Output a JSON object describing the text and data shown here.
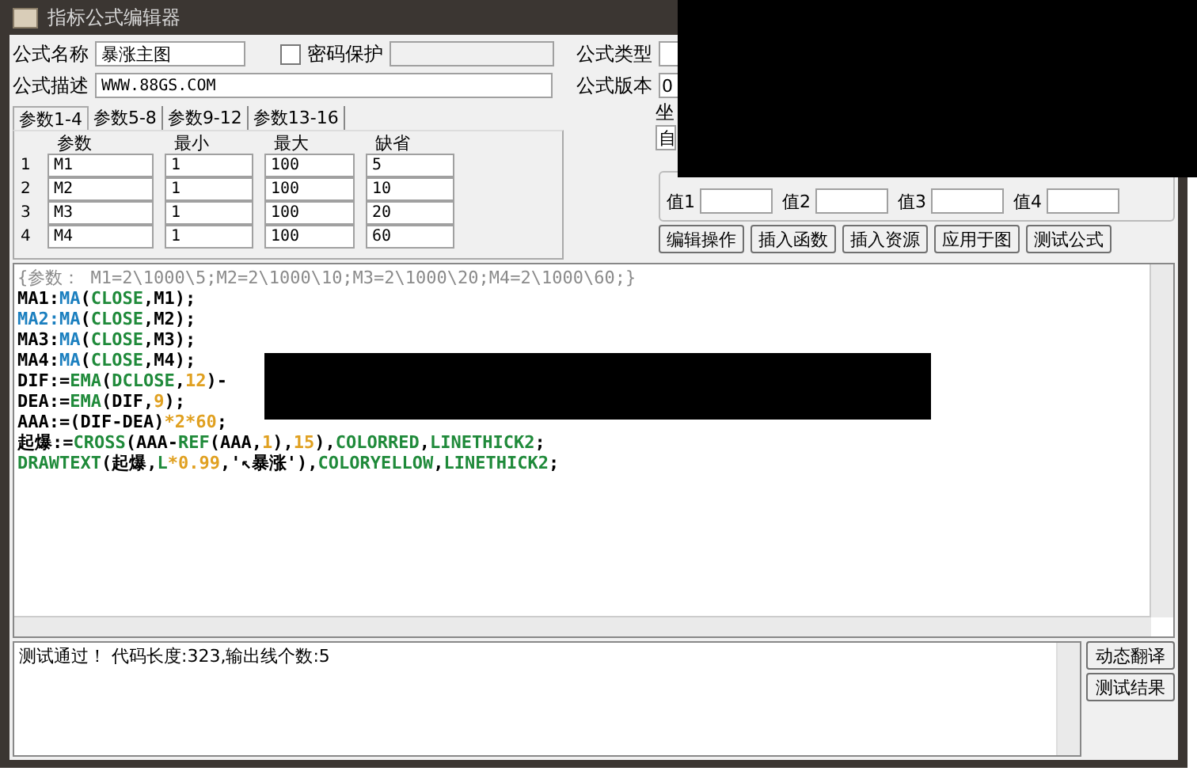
{
  "window": {
    "title": "指标公式编辑器"
  },
  "form": {
    "name_label": "公式名称",
    "name_value": "暴涨主图",
    "password": {
      "label": "密码保护",
      "checked": false
    },
    "type_label": "公式类型",
    "desc_label": "公式描述",
    "desc_value": "WWW.88GS.COM",
    "version_label": "公式版本",
    "version_value": "0",
    "axis_label": "坐",
    "axis_value": "自"
  },
  "tabs": [
    {
      "label": "参数1-4",
      "selected": true
    },
    {
      "label": "参数5-8",
      "selected": false
    },
    {
      "label": "参数9-12",
      "selected": false
    },
    {
      "label": "参数13-16",
      "selected": false
    }
  ],
  "params": {
    "columns": [
      "参数",
      "最小",
      "最大",
      "缺省"
    ],
    "rows": [
      {
        "index": "1",
        "cells": [
          "M1",
          "1",
          "100",
          "5"
        ]
      },
      {
        "index": "2",
        "cells": [
          "M2",
          "1",
          "100",
          "10"
        ]
      },
      {
        "index": "3",
        "cells": [
          "M3",
          "1",
          "100",
          "20"
        ]
      },
      {
        "index": "4",
        "cells": [
          "M4",
          "1",
          "100",
          "60"
        ]
      }
    ]
  },
  "values": [
    {
      "label": "值1"
    },
    {
      "label": "值2"
    },
    {
      "label": "值3"
    },
    {
      "label": "值4"
    }
  ],
  "buttons": [
    "编辑操作",
    "插入函数",
    "插入资源",
    "应用于图",
    "测试公式"
  ],
  "code": [
    [
      {
        "kind": "comment",
        "text": "{参数： M1=2\\1000\\5;M2=2\\1000\\10;M3=2\\1000\\20;M4=2\\1000\\60;}"
      }
    ],
    [
      {
        "kind": "plain",
        "text": "MA1:"
      },
      {
        "kind": "func",
        "text": "MA"
      },
      {
        "kind": "plain",
        "text": "("
      },
      {
        "kind": "builtin",
        "text": "CLOSE"
      },
      {
        "kind": "plain",
        "text": ",M1);"
      }
    ],
    [
      {
        "kind": "func",
        "text": "MA2:MA"
      },
      {
        "kind": "plain",
        "text": "("
      },
      {
        "kind": "builtin",
        "text": "CLOSE"
      },
      {
        "kind": "plain",
        "text": ",M2);"
      }
    ],
    [
      {
        "kind": "plain",
        "text": "MA3:"
      },
      {
        "kind": "func",
        "text": "MA"
      },
      {
        "kind": "plain",
        "text": "("
      },
      {
        "kind": "builtin",
        "text": "CLOSE"
      },
      {
        "kind": "plain",
        "text": ",M3);"
      }
    ],
    [
      {
        "kind": "plain",
        "text": "MA4:"
      },
      {
        "kind": "func",
        "text": "MA"
      },
      {
        "kind": "plain",
        "text": "("
      },
      {
        "kind": "builtin",
        "text": "CLOSE"
      },
      {
        "kind": "plain",
        "text": ",M4);"
      }
    ],
    [
      {
        "kind": "plain",
        "text": "DIF:="
      },
      {
        "kind": "builtin",
        "text": "EMA"
      },
      {
        "kind": "plain",
        "text": "("
      },
      {
        "kind": "builtin",
        "text": "DCLOSE"
      },
      {
        "kind": "plain",
        "text": ","
      },
      {
        "kind": "number",
        "text": "12"
      },
      {
        "kind": "plain",
        "text": ")-"
      }
    ],
    [
      {
        "kind": "plain",
        "text": "DEA:="
      },
      {
        "kind": "builtin",
        "text": "EMA"
      },
      {
        "kind": "plain",
        "text": "(DIF,"
      },
      {
        "kind": "number",
        "text": "9"
      },
      {
        "kind": "plain",
        "text": ");"
      }
    ],
    [
      {
        "kind": "plain",
        "text": "AAA:=(DIF-DEA)"
      },
      {
        "kind": "number",
        "text": "*2*60"
      },
      {
        "kind": "plain",
        "text": ";"
      }
    ],
    [
      {
        "kind": "plain",
        "text": "起爆:="
      },
      {
        "kind": "builtin",
        "text": "CROSS"
      },
      {
        "kind": "plain",
        "text": "(AAA-"
      },
      {
        "kind": "builtin",
        "text": "REF"
      },
      {
        "kind": "plain",
        "text": "(AAA,"
      },
      {
        "kind": "number",
        "text": "1"
      },
      {
        "kind": "plain",
        "text": "),"
      },
      {
        "kind": "number",
        "text": "15"
      },
      {
        "kind": "plain",
        "text": "),"
      },
      {
        "kind": "builtin",
        "text": "COLORRED"
      },
      {
        "kind": "plain",
        "text": ","
      },
      {
        "kind": "builtin",
        "text": "LINETHICK2"
      },
      {
        "kind": "plain",
        "text": ";"
      }
    ],
    [
      {
        "kind": "builtin",
        "text": "DRAWTEXT"
      },
      {
        "kind": "plain",
        "text": "(起爆,"
      },
      {
        "kind": "builtin",
        "text": "L"
      },
      {
        "kind": "number",
        "text": "*0.99"
      },
      {
        "kind": "plain",
        "text": ",'↖暴涨'),"
      },
      {
        "kind": "builtin",
        "text": "COLORYELLOW"
      },
      {
        "kind": "plain",
        "text": ","
      },
      {
        "kind": "builtin",
        "text": "LINETHICK2"
      },
      {
        "kind": "plain",
        "text": ";"
      }
    ]
  ],
  "result": {
    "text": "测试通过！ 代码长度:323,输出线个数:5"
  },
  "side_buttons": [
    "动态翻译",
    "测试结果"
  ]
}
